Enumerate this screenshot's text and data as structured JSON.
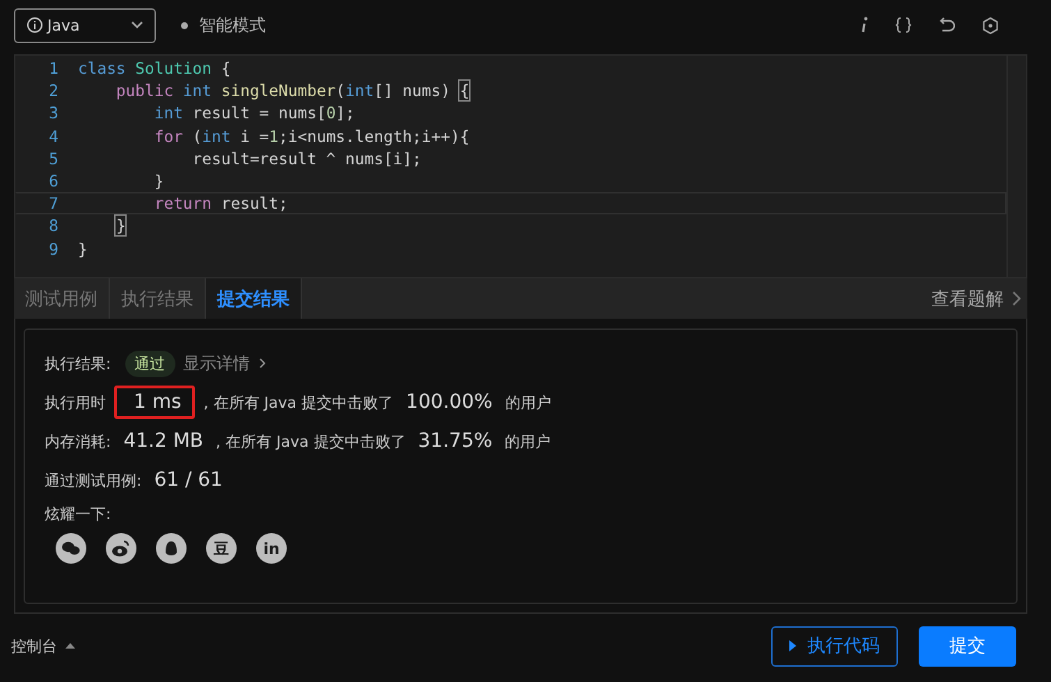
{
  "toolbar": {
    "language": "Java",
    "mode": "智能模式",
    "icons": [
      {
        "kind": "info"
      },
      {
        "kind": "braces"
      },
      {
        "kind": "undo"
      },
      {
        "kind": "settings"
      }
    ]
  },
  "editor": {
    "lines": [
      {
        "number": "1",
        "active": false,
        "tokens": [
          {
            "kind": "type",
            "text": "class"
          },
          {
            "kind": "cls",
            "text": " Solution"
          },
          {
            "kind": "plain",
            "text": " {"
          }
        ]
      },
      {
        "number": "2",
        "active": false,
        "tokens": [
          {
            "kind": "kw",
            "text": "    public"
          },
          {
            "kind": "type",
            "text": " int"
          },
          {
            "kind": "fn",
            "text": " singleNumber"
          },
          {
            "kind": "plain",
            "text": "("
          },
          {
            "kind": "type",
            "text": "int"
          },
          {
            "kind": "plain",
            "text": "[] nums) "
          },
          {
            "kind": "match",
            "text": "{"
          }
        ]
      },
      {
        "number": "3",
        "active": false,
        "tokens": [
          {
            "kind": "type",
            "text": "        int"
          },
          {
            "kind": "plain",
            "text": " result = nums["
          },
          {
            "kind": "num",
            "text": "0"
          },
          {
            "kind": "plain",
            "text": "];"
          }
        ]
      },
      {
        "number": "4",
        "active": false,
        "tokens": [
          {
            "kind": "kw",
            "text": "        for"
          },
          {
            "kind": "plain",
            "text": " ("
          },
          {
            "kind": "type",
            "text": "int"
          },
          {
            "kind": "plain",
            "text": " i ="
          },
          {
            "kind": "num",
            "text": "1"
          },
          {
            "kind": "plain",
            "text": ";i<nums.length;i++){"
          }
        ]
      },
      {
        "number": "5",
        "active": false,
        "tokens": [
          {
            "kind": "plain",
            "text": "            result=result ^ nums[i];"
          }
        ]
      },
      {
        "number": "6",
        "active": false,
        "tokens": [
          {
            "kind": "plain",
            "text": "        }"
          }
        ]
      },
      {
        "number": "7",
        "active": true,
        "tokens": [
          {
            "kind": "kw",
            "text": "        return"
          },
          {
            "kind": "plain",
            "text": " result;"
          }
        ]
      },
      {
        "number": "8",
        "active": false,
        "tokens": [
          {
            "kind": "match",
            "text": "    }"
          }
        ]
      },
      {
        "number": "9",
        "active": false,
        "tokens": [
          {
            "kind": "plain",
            "text": "}"
          }
        ]
      }
    ]
  },
  "tabs": [
    {
      "label": "测试用例",
      "selected": false
    },
    {
      "label": "执行结果",
      "selected": false
    },
    {
      "label": "提交结果",
      "selected": true
    }
  ],
  "solution_link": "查看题解",
  "result": {
    "label": "执行结果:",
    "badge": "通过",
    "detail_link": "显示详情"
  },
  "stats": [
    {
      "label": "执行用时",
      "value": "1 ms",
      "highlighted": true,
      "text": ", 在所有 Java 提交中击败了",
      "percent": "100.00%",
      "suffix": "的用户"
    },
    {
      "label": "内存消耗:",
      "value": "41.2 MB",
      "highlighted": false,
      "text": ", 在所有 Java 提交中击败了",
      "percent": "31.75%",
      "suffix": "的用户"
    }
  ],
  "tests": {
    "label": "通过测试用例:",
    "value": "61 / 61"
  },
  "share": {
    "label": "炫耀一下:",
    "items": [
      {
        "kind": "wechat"
      },
      {
        "kind": "weibo"
      },
      {
        "kind": "qq"
      },
      {
        "kind": "glyph",
        "glyph": "豆"
      },
      {
        "kind": "glyph",
        "glyph": "in"
      }
    ]
  },
  "footer": {
    "console": "控制台",
    "run_button": "执行代码",
    "submit_button": "提交"
  }
}
